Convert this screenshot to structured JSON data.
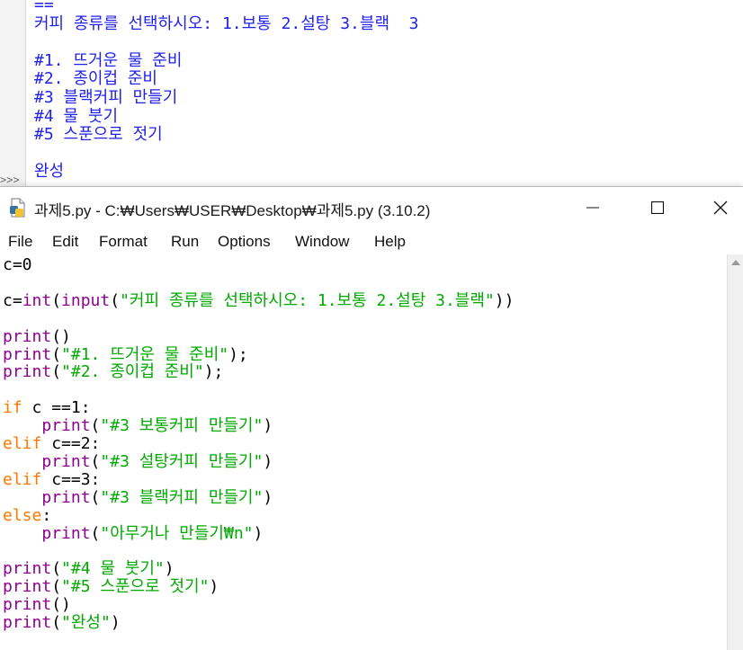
{
  "shell": {
    "lines": [
      "==",
      "커피 종류를 선택하시오: 1.보통 2.설탕 3.블랙  3",
      "",
      "#1. 뜨거운 물 준비",
      "#2. 종이컵 준비",
      "#3 블랙커피 만들기",
      "#4 물 붓기",
      "#5 스푼으로 젓기",
      "",
      "완성"
    ],
    "prompt": ">>>"
  },
  "window": {
    "title": "과제5.py - C:₩Users₩USER₩Desktop₩과제5.py (3.10.2)",
    "icon": "python-file-icon",
    "controls": {
      "minimize": "minimize-icon",
      "maximize": "maximize-icon",
      "close": "close-icon"
    }
  },
  "menu": [
    "File",
    "Edit",
    "Format",
    "Run",
    "Options",
    "Window",
    "Help"
  ],
  "code": [
    [
      [
        "t",
        "c=0"
      ]
    ],
    [],
    [
      [
        "t",
        "c="
      ],
      [
        "b",
        "int"
      ],
      [
        "t",
        "("
      ],
      [
        "b",
        "input"
      ],
      [
        "t",
        "("
      ],
      [
        "s",
        "\"커피 종류를 선택하시오: 1.보통 2.설탕 3.블랙\""
      ],
      [
        "t",
        "))"
      ]
    ],
    [],
    [
      [
        "b",
        "print"
      ],
      [
        "t",
        "()"
      ]
    ],
    [
      [
        "b",
        "print"
      ],
      [
        "t",
        "("
      ],
      [
        "s",
        "\"#1. 뜨거운 물 준비\""
      ],
      [
        "t",
        ");"
      ]
    ],
    [
      [
        "b",
        "print"
      ],
      [
        "t",
        "("
      ],
      [
        "s",
        "\"#2. 종이컵 준비\""
      ],
      [
        "t",
        ");"
      ]
    ],
    [],
    [
      [
        "k",
        "if"
      ],
      [
        "t",
        " c ==1:"
      ]
    ],
    [
      [
        "t",
        "    "
      ],
      [
        "b",
        "print"
      ],
      [
        "t",
        "("
      ],
      [
        "s",
        "\"#3 보통커피 만들기\""
      ],
      [
        "t",
        ")"
      ]
    ],
    [
      [
        "k",
        "elif"
      ],
      [
        "t",
        " c==2:"
      ]
    ],
    [
      [
        "t",
        "    "
      ],
      [
        "b",
        "print"
      ],
      [
        "t",
        "("
      ],
      [
        "s",
        "\"#3 설탕커피 만들기\""
      ],
      [
        "t",
        ")"
      ]
    ],
    [
      [
        "k",
        "elif"
      ],
      [
        "t",
        " c==3:"
      ]
    ],
    [
      [
        "t",
        "    "
      ],
      [
        "b",
        "print"
      ],
      [
        "t",
        "("
      ],
      [
        "s",
        "\"#3 블랙커피 만들기\""
      ],
      [
        "t",
        ")"
      ]
    ],
    [
      [
        "k",
        "else"
      ],
      [
        "t",
        ":"
      ]
    ],
    [
      [
        "t",
        "    "
      ],
      [
        "b",
        "print"
      ],
      [
        "t",
        "("
      ],
      [
        "s",
        "\"아무거나 만들기₩n\""
      ],
      [
        "t",
        ")"
      ]
    ],
    [],
    [
      [
        "b",
        "print"
      ],
      [
        "t",
        "("
      ],
      [
        "s",
        "\"#4 물 붓기\""
      ],
      [
        "t",
        ")"
      ]
    ],
    [
      [
        "b",
        "print"
      ],
      [
        "t",
        "("
      ],
      [
        "s",
        "\"#5 스푼으로 젓기\""
      ],
      [
        "t",
        ")"
      ]
    ],
    [
      [
        "b",
        "print"
      ],
      [
        "t",
        "()"
      ]
    ],
    [
      [
        "b",
        "print"
      ],
      [
        "t",
        "("
      ],
      [
        "s",
        "\"완성\""
      ],
      [
        "t",
        ")"
      ]
    ]
  ],
  "colors": {
    "keyword": "#ff7700",
    "builtin": "#900090",
    "string": "#00aa00",
    "shell_output": "#2222e8"
  }
}
